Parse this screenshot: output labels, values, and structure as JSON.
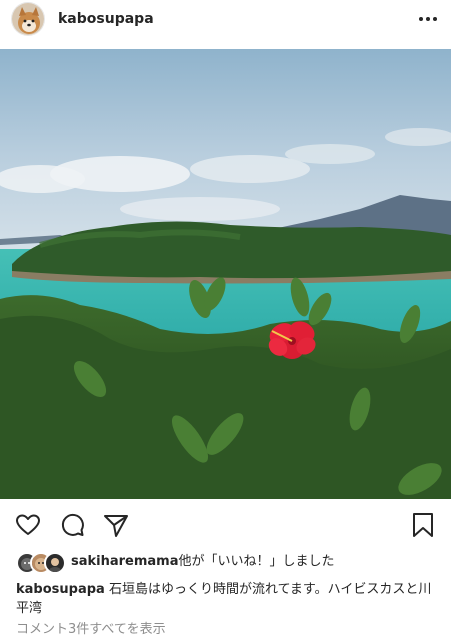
{
  "post": {
    "username": "kabosupapa",
    "more_icon": "more-horizontal-icon",
    "photo_subject": "island-sea-hibiscus-photo"
  },
  "actions": {
    "like_icon": "heart-icon",
    "comment_icon": "comment-icon",
    "share_icon": "send-icon",
    "save_icon": "bookmark-icon"
  },
  "likes": {
    "user": "sakiharemama",
    "suffix": "他が「いいね！」しました"
  },
  "caption": {
    "user": "kabosupapa",
    "text": "石垣島はゆっくり時間が流れてます。ハイビスカスと川平湾"
  },
  "comments": {
    "link_text": "コメント3件すべてを表示"
  },
  "colors": {
    "text": "#262626",
    "muted": "#8e8e8e",
    "hibiscus": "#e8203a",
    "sea": "#3fc3bb"
  }
}
